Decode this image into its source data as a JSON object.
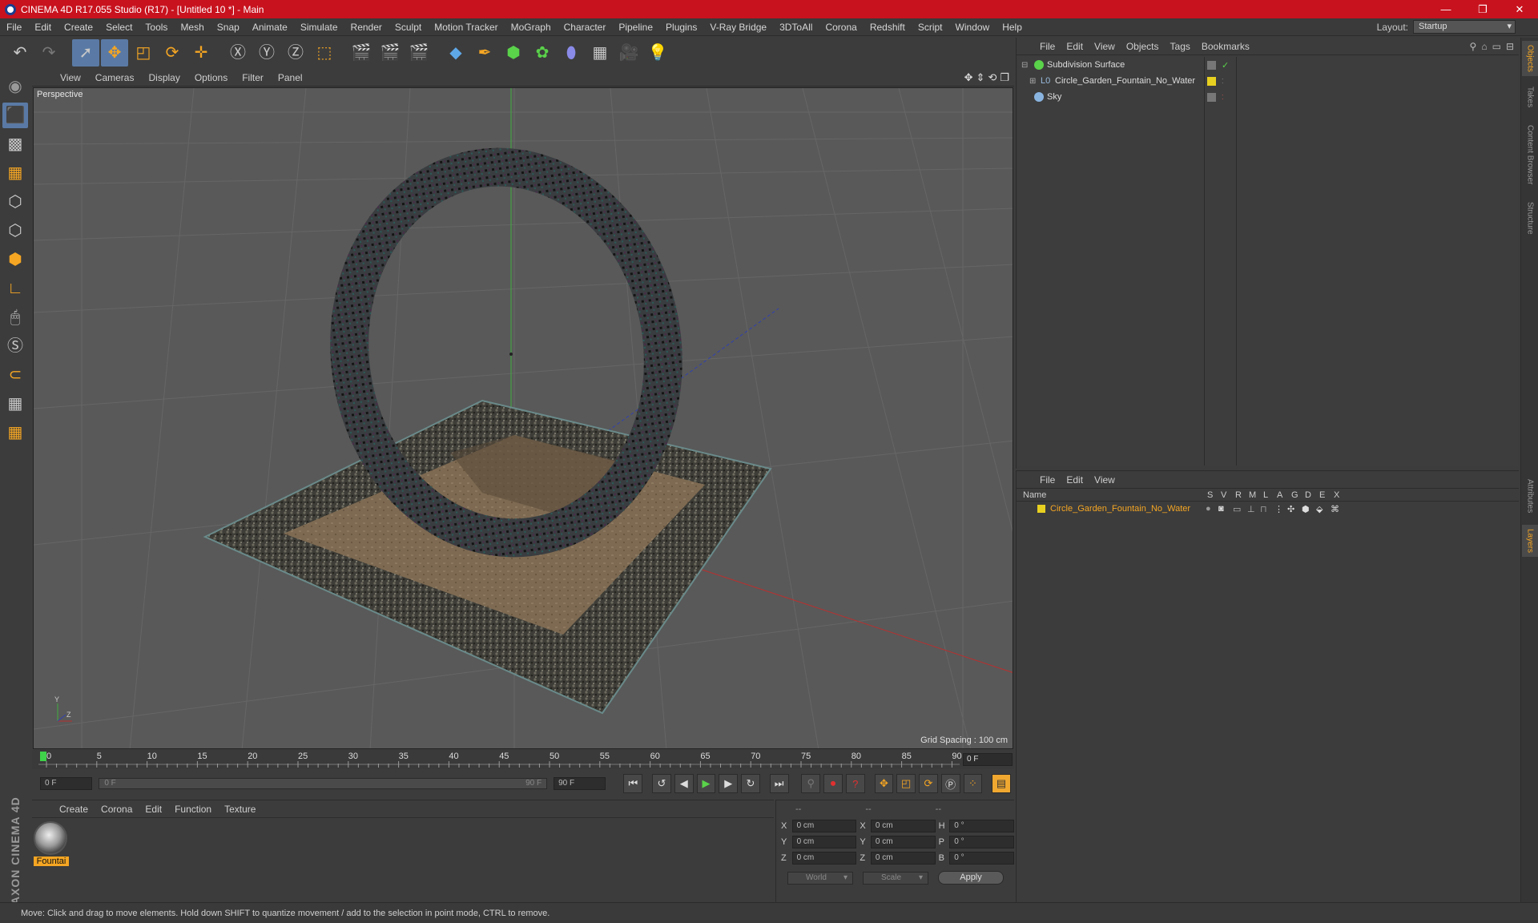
{
  "window": {
    "title": "CINEMA 4D R17.055 Studio (R17) - [Untitled 10 *] - Main",
    "minimize": "—",
    "restore": "❐",
    "close": "✕"
  },
  "menu": [
    "File",
    "Edit",
    "Create",
    "Select",
    "Tools",
    "Mesh",
    "Snap",
    "Animate",
    "Simulate",
    "Render",
    "Sculpt",
    "Motion Tracker",
    "MoGraph",
    "Character",
    "Pipeline",
    "Plugins",
    "V-Ray Bridge",
    "3DToAll",
    "Corona",
    "Redshift",
    "Script",
    "Window",
    "Help"
  ],
  "layout": {
    "label": "Layout:",
    "value": "Startup"
  },
  "viewport": {
    "menu": [
      "View",
      "Cameras",
      "Display",
      "Options",
      "Filter",
      "Panel"
    ],
    "label": "Perspective",
    "grid_spacing": "Grid Spacing : 100 cm",
    "axis_y": "Y",
    "axis_z": "Z"
  },
  "timeline": {
    "ticks": [
      "0",
      "5",
      "10",
      "15",
      "20",
      "25",
      "30",
      "35",
      "40",
      "45",
      "50",
      "55",
      "60",
      "65",
      "70",
      "75",
      "80",
      "85",
      "90"
    ],
    "frame": "0 F"
  },
  "transport": {
    "start": "0 F",
    "slider_left": "0 F",
    "slider_right": "90 F",
    "end": "90 F"
  },
  "material_panel": {
    "menu": [
      "Create",
      "Corona",
      "Edit",
      "Function",
      "Texture"
    ],
    "material_label": "Fountai"
  },
  "brand": "MAXON CINEMA 4D",
  "coords": {
    "headers": [
      "--",
      "--",
      "--"
    ],
    "rows": [
      {
        "a": "X",
        "v1": "0 cm",
        "b": "X",
        "v2": "0 cm",
        "c": "H",
        "v3": "0 °"
      },
      {
        "a": "Y",
        "v1": "0 cm",
        "b": "Y",
        "v2": "0 cm",
        "c": "P",
        "v3": "0 °"
      },
      {
        "a": "Z",
        "v1": "0 cm",
        "b": "Z",
        "v2": "0 cm",
        "c": "B",
        "v3": "0 °"
      }
    ],
    "mode1": "World",
    "mode2": "Scale",
    "apply": "Apply"
  },
  "status": "Move: Click and drag to move elements. Hold down SHIFT to quantize movement / add to the selection in point mode, CTRL to remove.",
  "objects": {
    "menu": [
      "File",
      "Edit",
      "View",
      "Objects",
      "Tags",
      "Bookmarks"
    ],
    "items": [
      {
        "name": "Subdivision Surface"
      },
      {
        "name": "Circle_Garden_Fountain_No_Water"
      },
      {
        "name": "Sky"
      }
    ]
  },
  "layers": {
    "menu": [
      "File",
      "Edit",
      "View"
    ],
    "header_name": "Name",
    "columns": [
      "S",
      "V",
      "R",
      "M",
      "L",
      "A",
      "G",
      "D",
      "E",
      "X"
    ],
    "items": [
      {
        "name": "Circle_Garden_Fountain_No_Water"
      }
    ]
  },
  "side_tabs": [
    "Objects",
    "Takes",
    "Content Browser",
    "Structure",
    "Attributes",
    "Layers"
  ],
  "colors": {
    "title_bar": "#c8121e",
    "accent": "#f5a623",
    "selected_tool": "#5a7aa5"
  }
}
